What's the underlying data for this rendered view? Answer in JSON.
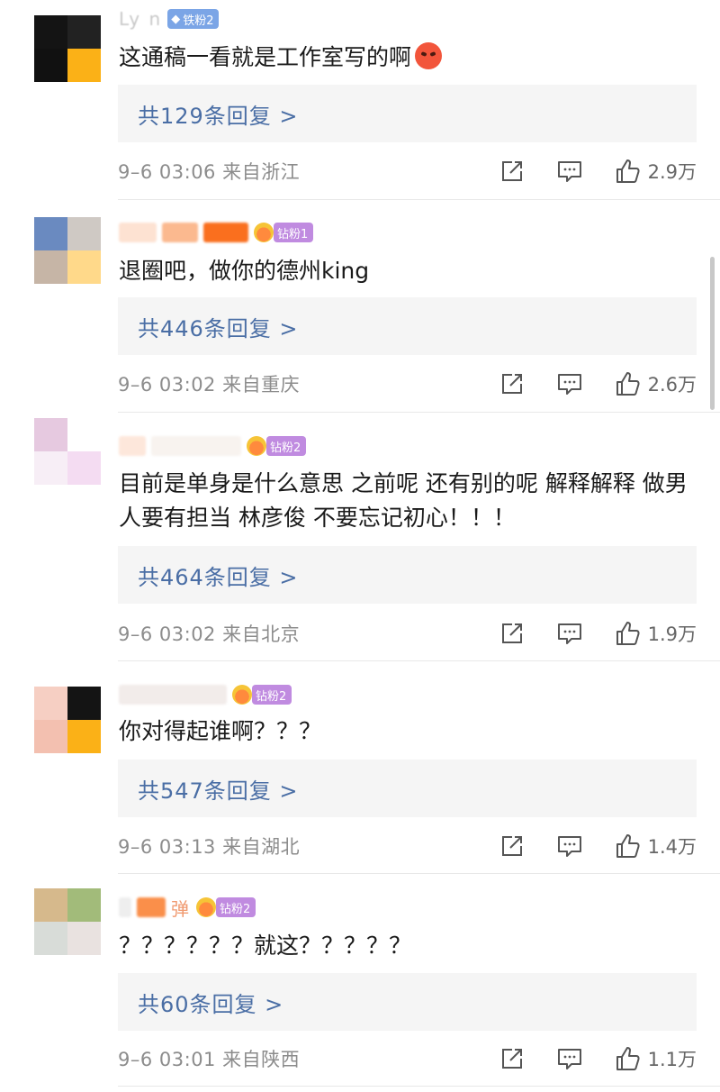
{
  "comments": [
    {
      "user_partial": "Ly n",
      "badge": "铁粉2",
      "text": "这通稿一看就是工作室写的啊",
      "replies": "共129条回复 >",
      "meta": "9–6 03:06  来自浙江",
      "likes": "2.9万"
    },
    {
      "badge": "钻粉1",
      "text": "退圈吧，做你的德州king",
      "replies": "共446条回复 >",
      "meta": "9–6 03:02  来自重庆",
      "likes": "2.6万"
    },
    {
      "badge": "钻粉2",
      "text": "目前是单身是什么意思 之前呢 还有别的呢 解释解释 做男人要有担当 林彦俊 不要忘记初心！！！",
      "replies": "共464条回复 >",
      "meta": "9–6 03:02  来自北京",
      "likes": "1.9万"
    },
    {
      "badge": "钻粉2",
      "text": "你对得起谁啊？？？",
      "replies": "共547条回复 >",
      "meta": "9–6 03:13  来自湖北",
      "likes": "1.4万"
    },
    {
      "user_partial": "弹",
      "badge": "钻粉2",
      "text": "？？？？？？就这？？？？？",
      "replies": "共60条回复 >",
      "meta": "9–6 03:01  来自陕西",
      "likes": "1.1万"
    }
  ],
  "icons": {
    "share": "share-icon",
    "comment": "comment-icon",
    "like": "thumbs-up-icon",
    "badge_gem": "diamond-gem-icon",
    "badge_crown": "crown-icon"
  },
  "colors": {
    "reply_link": "#4a6ea5",
    "reply_bg": "#f5f5f5",
    "iron_badge": "#7ba5e6",
    "diamond_badge": "#c08be0",
    "meta_text": "#8c8c8c"
  }
}
